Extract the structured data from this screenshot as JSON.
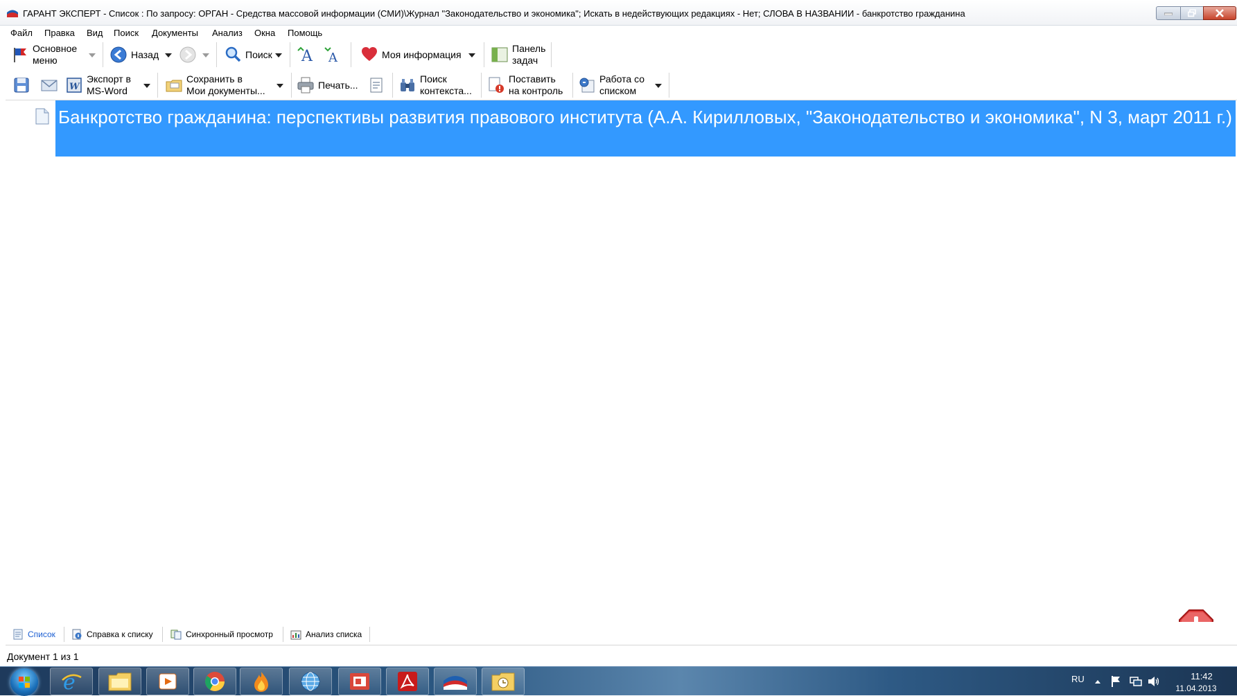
{
  "window": {
    "title": "ГАРАНТ ЭКСПЕРТ - Список : По запросу: ОРГАН - Средства массовой информации (СМИ)\\Журнал \"Законодательство и экономика\"; Искать в недействующих редакциях - Нет; СЛОВА В НАЗВАНИИ - банкротство гражданина"
  },
  "menu": [
    "Файл",
    "Правка",
    "Вид",
    "Поиск",
    "Документы",
    "Анализ",
    "Окна",
    "Помощь"
  ],
  "toolbar1": {
    "main_menu": "Основное\nменю",
    "back": "Назад",
    "search": "Поиск",
    "my_info": "Моя информация",
    "task_panel": "Панель\nзадач"
  },
  "toolbar2": {
    "export_word": "Экспорт в\nMS-Word",
    "save_my_docs": "Сохранить в\nМои документы...",
    "print": "Печать...",
    "context_search": "Поиск\nконтекста...",
    "put_control": "Поставить\nна контроль",
    "work_with_list": "Работа со\nсписком"
  },
  "list": {
    "items": [
      {
        "title": "Банкротство гражданина: перспективы развития правового института (А.А.  Кирилловых, \"Законодательство и экономика\", N 3, март 2011 г.)",
        "selected": true
      }
    ]
  },
  "tabs": [
    "Список",
    "Справка к списку",
    "Синхронный просмотр",
    "Анализ списка"
  ],
  "status": {
    "text": "Документ 1 из 1"
  },
  "taskbar": {
    "language": "RU",
    "time": "11:42",
    "date": "11.04.2013"
  },
  "colors": {
    "selection": "#3399ff",
    "active_tab": "#1c5fd3",
    "taskbar": "#2a5680"
  }
}
